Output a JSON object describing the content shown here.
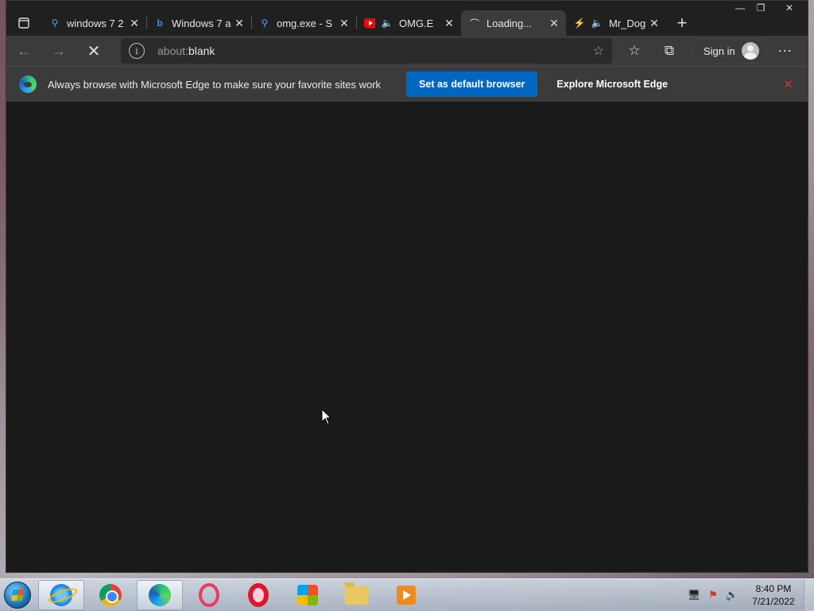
{
  "browser": {
    "tabs": [
      {
        "favicon": "search-icon",
        "title": "windows 7 2",
        "active": false
      },
      {
        "favicon": "bing-icon",
        "title": "Windows 7 a",
        "active": false
      },
      {
        "favicon": "search-icon",
        "title": "omg.exe - S",
        "active": false
      },
      {
        "favicon": "youtube-icon",
        "audio": true,
        "title": "OMG.E",
        "active": false
      },
      {
        "favicon": "loading-spinner-icon",
        "title": "Loading...",
        "active": true
      },
      {
        "favicon": "lightning-icon",
        "audio": true,
        "title": "Mr_Dog",
        "active": false
      }
    ],
    "address": {
      "scheme": "about:",
      "path": "blank"
    },
    "sign_in_label": "Sign in"
  },
  "infobar": {
    "message": "Always browse with Microsoft Edge to make sure your favorite sites work",
    "primary_label": "Set as default browser",
    "secondary_label": "Explore Microsoft Edge"
  },
  "taskbar": {
    "apps": [
      "internet-explorer",
      "chrome",
      "edge",
      "opera-gx",
      "opera",
      "windows-xp-app",
      "file-explorer",
      "media-player"
    ],
    "active_app": "edge",
    "clock_time": "8:40 PM",
    "clock_date": "7/21/2022"
  },
  "colors": {
    "accent": "#0067c0",
    "content_bg": "#1a1a1a",
    "toolbar_bg": "#3b3b3b"
  }
}
